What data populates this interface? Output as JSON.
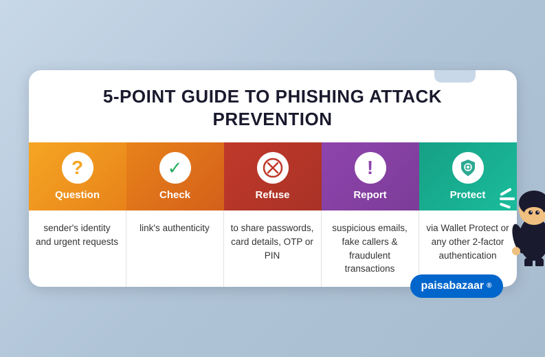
{
  "title": {
    "line1": "5-POINT GUIDE TO PHISHING ATTACK",
    "line2": "PREVENTION"
  },
  "columns": [
    {
      "id": "question",
      "label": "Question",
      "icon": "?",
      "iconType": "question",
      "bodyText": "sender's identity and urgent requests",
      "color": "#f5a623"
    },
    {
      "id": "check",
      "label": "Check",
      "icon": "✓",
      "iconType": "check",
      "bodyText": "link's authenticity",
      "color": "#e8821a"
    },
    {
      "id": "refuse",
      "label": "Refuse",
      "icon": "✕",
      "iconType": "refuse",
      "bodyText": "to share passwords, card details, OTP or PIN",
      "color": "#c0392b"
    },
    {
      "id": "report",
      "label": "Report",
      "icon": "!",
      "iconType": "report",
      "bodyText": "suspicious emails, fake callers & fraudulent transactions",
      "color": "#8e44ad"
    },
    {
      "id": "protect",
      "label": "Protect",
      "icon": "🛡",
      "iconType": "protect",
      "bodyText": "via Wallet Protect or any other 2-factor authentication",
      "color": "#16a085"
    }
  ],
  "branding": {
    "text": "paisabazaar",
    "suffix": "®"
  }
}
